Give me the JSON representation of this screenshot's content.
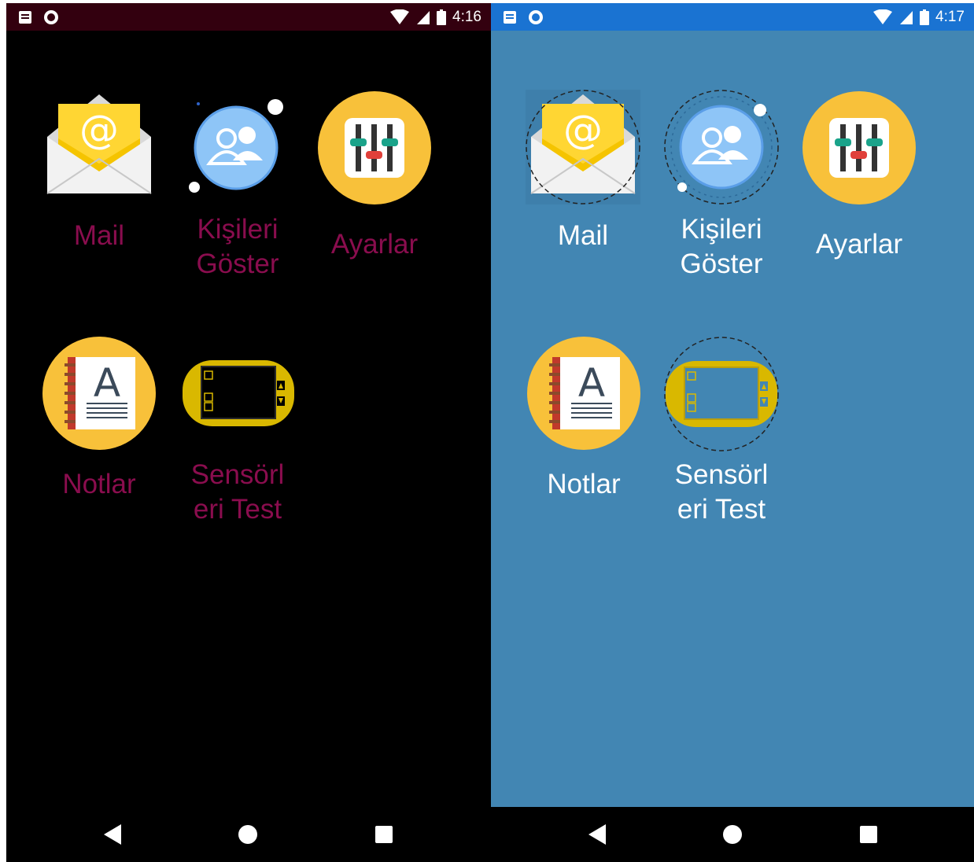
{
  "screens": [
    {
      "id": "left",
      "status_time": "4:16",
      "apps": [
        {
          "label": "Mail"
        },
        {
          "label": "Kişileri\nGöster"
        },
        {
          "label": "Ayarlar"
        },
        {
          "label": "Notlar"
        },
        {
          "label": "Sensörl\neri Test"
        }
      ]
    },
    {
      "id": "right",
      "status_time": "4:17",
      "apps": [
        {
          "label": "Mail"
        },
        {
          "label": "Kişileri\nGöster"
        },
        {
          "label": "Ayarlar"
        },
        {
          "label": "Notlar"
        },
        {
          "label": "Sensörl\neri Test"
        }
      ]
    }
  ],
  "colors": {
    "left_background": "#000000",
    "left_statusbar": "#33000f",
    "left_label": "#8a0d4e",
    "right_background": "#4286b3",
    "right_statusbar": "#1a73d2",
    "right_label": "#ffffff"
  },
  "icons": [
    "notification-icon",
    "sync-icon",
    "wifi-icon",
    "signal-icon",
    "battery-icon",
    "mail-app-icon",
    "contacts-app-icon",
    "settings-app-icon",
    "notes-app-icon",
    "sensor-test-app-icon",
    "back-icon",
    "home-icon",
    "recents-icon"
  ]
}
